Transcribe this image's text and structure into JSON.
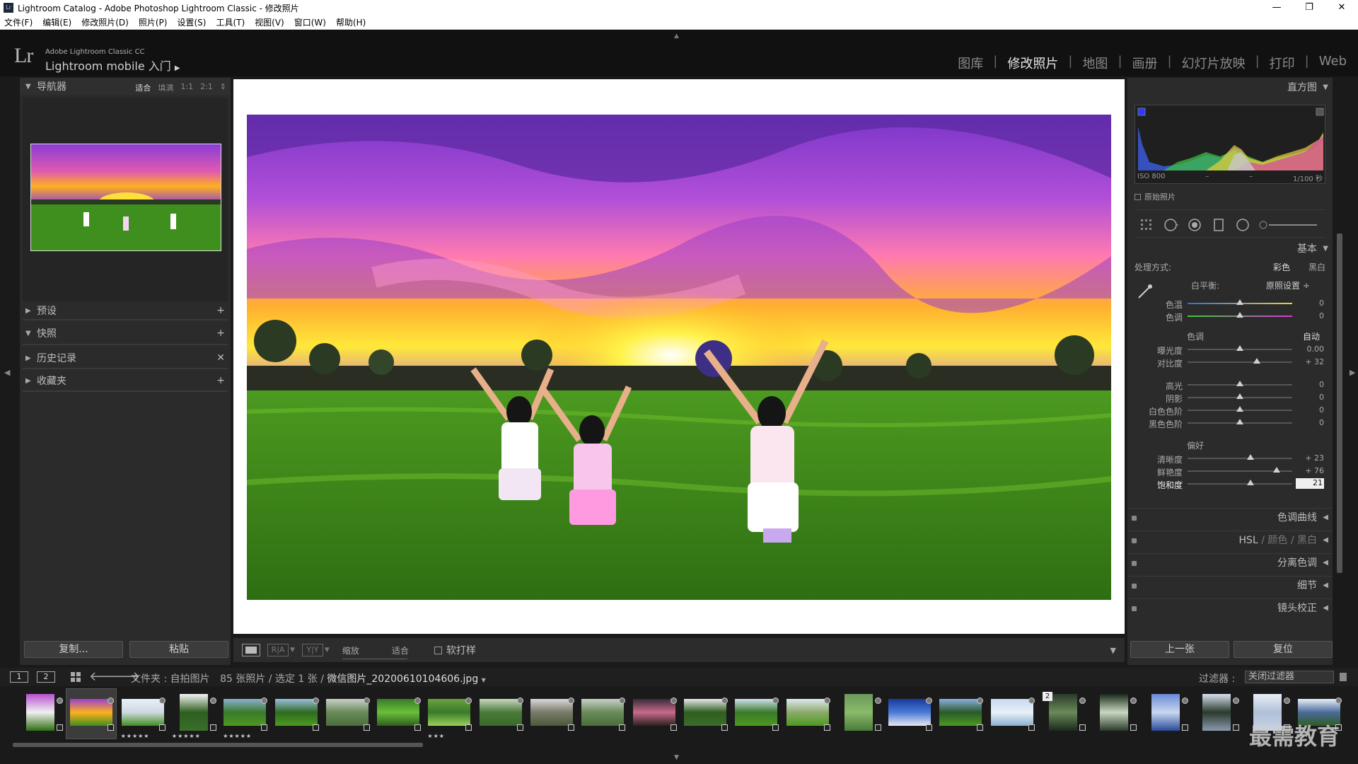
{
  "window": {
    "title": "Lightroom Catalog - Adobe Photoshop Lightroom Classic - 修改照片",
    "app_icon": "Lr",
    "controls": {
      "minimize": "—",
      "restore": "❐",
      "close": "✕"
    }
  },
  "menu": [
    "文件(F)",
    "编辑(E)",
    "修改照片(D)",
    "照片(P)",
    "设置(S)",
    "工具(T)",
    "视图(V)",
    "窗口(W)",
    "帮助(H)"
  ],
  "identity": {
    "logo": "Lr",
    "product": "Adobe Lightroom Classic CC",
    "mobile": "Lightroom mobile 入门",
    "mobile_arrow": "▶"
  },
  "modules": [
    "图库",
    "修改照片",
    "地图",
    "画册",
    "幻灯片放映",
    "打印",
    "Web"
  ],
  "active_module": "修改照片",
  "left_panel": {
    "navigator": {
      "title": "导航器",
      "options": [
        "适合",
        "填满",
        "1:1",
        "2:1"
      ],
      "active_option": "适合",
      "more": "⇕"
    },
    "sections": [
      {
        "title": "预设",
        "action": "+"
      },
      {
        "title": "快照",
        "action": "+"
      },
      {
        "title": "历史记录",
        "action": "✕"
      },
      {
        "title": "收藏夹",
        "action": "+"
      }
    ],
    "copy_button": "复制...",
    "paste_button": "粘贴"
  },
  "toolbar": {
    "view_a": "R|A",
    "view_b": "Y|Y",
    "zoom_label": "缩放",
    "fit_label": "适合",
    "soft_proof": "软打样",
    "menu_arrow": "▼"
  },
  "right_panel": {
    "histogram": {
      "title": "直方图",
      "iso": "ISO 800",
      "focal": "–",
      "aperture": "–",
      "shutter": "1/100 秒",
      "original_photo": "原始照片"
    },
    "basic": {
      "title": "基本",
      "treatment_label": "处理方式:",
      "treatment_color": "彩色",
      "treatment_bw": "黑白",
      "wb_label": "白平衡:",
      "wb_value": "原照设置 ÷",
      "tone_label": "色调",
      "auto": "自动",
      "presence_label": "偏好",
      "sliders": [
        {
          "name": "temp",
          "label": "色温",
          "value": "0",
          "pos": 0.5
        },
        {
          "name": "tint",
          "label": "色调",
          "value": "0",
          "pos": 0.5
        },
        {
          "name": "exposure",
          "label": "曝光度",
          "value": "0.00",
          "pos": 0.5
        },
        {
          "name": "contrast",
          "label": "对比度",
          "value": "+ 32",
          "pos": 0.66
        },
        {
          "name": "highlights",
          "label": "高光",
          "value": "0",
          "pos": 0.5
        },
        {
          "name": "shadows",
          "label": "阴影",
          "value": "0",
          "pos": 0.5
        },
        {
          "name": "whites",
          "label": "白色色阶",
          "value": "0",
          "pos": 0.5
        },
        {
          "name": "blacks",
          "label": "黑色色阶",
          "value": "0",
          "pos": 0.5
        },
        {
          "name": "clarity",
          "label": "清晰度",
          "value": "+ 23",
          "pos": 0.6
        },
        {
          "name": "vibrance",
          "label": "鲜艳度",
          "value": "+ 76",
          "pos": 0.85
        },
        {
          "name": "saturation",
          "label": "饱和度",
          "value": "21",
          "pos": 0.6
        }
      ]
    },
    "collapsed_panels": [
      {
        "name": "tone-curve",
        "title": "色调曲线"
      },
      {
        "name": "hsl",
        "title": "HSL",
        "extra": [
          "颜色",
          "黑白"
        ]
      },
      {
        "name": "split-toning",
        "title": "分离色调"
      },
      {
        "name": "detail",
        "title": "细节"
      },
      {
        "name": "lens-corrections",
        "title": "镜头校正"
      }
    ],
    "prev_button": "上一张",
    "reset_button": "复位"
  },
  "filmstrip_bar": {
    "monitor1": "1",
    "monitor2": "2",
    "folder": "文件夹 : 自拍图片",
    "count": "85 张照片 / 选定 1 张 /",
    "filename": "微信图片_20200610104606.jpg",
    "filename_caret": "▼",
    "filter_label": "过滤器 :",
    "filter_value": "关闭过滤器"
  },
  "filmstrip": {
    "selected_index": 1,
    "thumbs": [
      {
        "stars": "",
        "stack": ""
      },
      {
        "stars": "",
        "stack": ""
      },
      {
        "stars": "★★★★★",
        "stack": ""
      },
      {
        "stars": "★★★★★",
        "stack": ""
      },
      {
        "stars": "★★★★★",
        "stack": ""
      },
      {
        "stars": "",
        "stack": ""
      },
      {
        "stars": "",
        "stack": ""
      },
      {
        "stars": "",
        "stack": ""
      },
      {
        "stars": "★★★",
        "stack": ""
      },
      {
        "stars": "",
        "stack": ""
      },
      {
        "stars": "",
        "stack": ""
      },
      {
        "stars": "",
        "stack": ""
      },
      {
        "stars": "",
        "stack": ""
      },
      {
        "stars": "",
        "stack": ""
      },
      {
        "stars": "",
        "stack": ""
      },
      {
        "stars": "",
        "stack": ""
      },
      {
        "stars": "",
        "stack": ""
      },
      {
        "stars": "",
        "stack": ""
      },
      {
        "stars": "",
        "stack": ""
      },
      {
        "stars": "",
        "stack": ""
      },
      {
        "stars": "",
        "stack": "2"
      },
      {
        "stars": "",
        "stack": ""
      },
      {
        "stars": "",
        "stack": ""
      },
      {
        "stars": "",
        "stack": ""
      },
      {
        "stars": "",
        "stack": ""
      },
      {
        "stars": "",
        "stack": ""
      }
    ]
  },
  "watermark": "最需教育",
  "colors": {
    "panel_bg": "#2b2b2b",
    "app_bg": "#1a1a1a",
    "accent_text": "#e6e6e6"
  }
}
